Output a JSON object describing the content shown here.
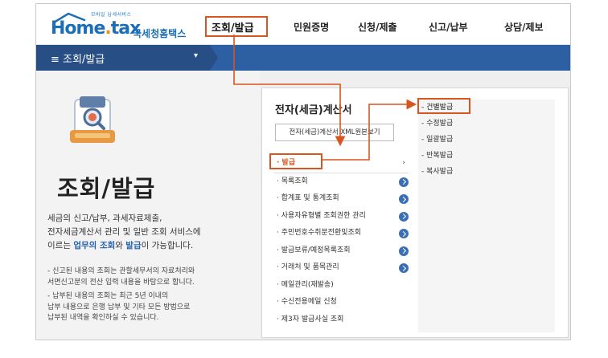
{
  "logo": {
    "tagline": "모바일 납세서비스",
    "home": "Hom",
    "e": "e",
    "tax": "tax",
    "dot": ".",
    "name": "국세청홈택스"
  },
  "nav": [
    "조회/발급",
    "민원증명",
    "신청/제출",
    "신고/납부",
    "상담/제보"
  ],
  "bluebar": {
    "label": "≡  조회/발급",
    "caret": "▾"
  },
  "left": {
    "title": "조회/발급",
    "desc_1": "세금의 신고/납부, 과세자료제출,",
    "desc_2": "전자세금계산서 관리 및 일반 조회 서비스에",
    "desc_3a": "이르는 ",
    "desc_3b": "업무의 조회",
    "desc_3c": "와 ",
    "desc_3d": "발급",
    "desc_3e": "이 가능합니다.",
    "note_1a": "- 신고된 내용의 조회는 관할세무서의 자료처리와",
    "note_1b": "  서면신고분의 전산 입력 내용을 바탕으로 합니다.",
    "note_2a": "- 납부된 내용의 조회는 최근 5년 이내의",
    "note_2b": "  납부 내용으로 은행 납부 및 기타 모든 방법으로",
    "note_2c": "  납부된 내역을 확인하실 수 있습니다."
  },
  "card": {
    "title": "전자(세금)계산서",
    "xml_button": "전자(세금)계산서 XML원본보기",
    "items": [
      "· 발급",
      "· 목록조회",
      "· 합계표 및 통계조회",
      "· 사용자유형별 조회권한 관리",
      "· 주민번호수취분전환및조회",
      "· 발급보류/예정목록조회",
      "· 거래처 및 품목관리",
      "· 메일관리(재발송)",
      "· 수신전용메일 신청",
      "· 제3자 발급사실 조회"
    ],
    "chevron": "›",
    "sub_items": [
      "- 건별발급",
      "- 수정발급",
      "- 일괄발급",
      "- 반복발급",
      "- 복사발급"
    ]
  },
  "colors": {
    "highlight": "#d9541e",
    "bar": "#2d5fa3",
    "bar_dark": "#274f86"
  }
}
